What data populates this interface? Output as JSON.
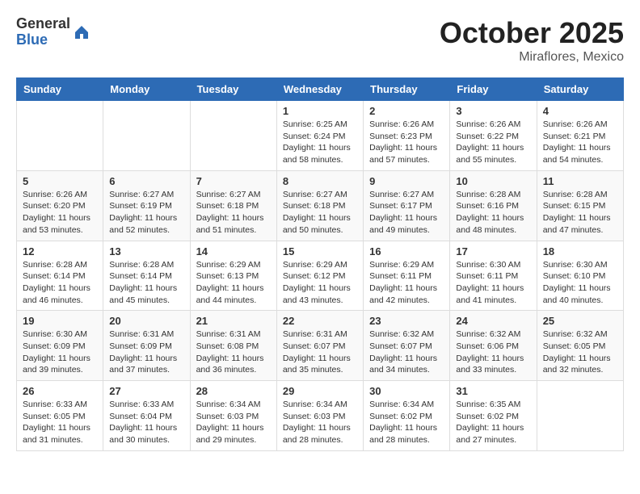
{
  "logo": {
    "general": "General",
    "blue": "Blue"
  },
  "header": {
    "month": "October 2025",
    "location": "Miraflores, Mexico"
  },
  "weekdays": [
    "Sunday",
    "Monday",
    "Tuesday",
    "Wednesday",
    "Thursday",
    "Friday",
    "Saturday"
  ],
  "weeks": [
    [
      {
        "day": "",
        "info": ""
      },
      {
        "day": "",
        "info": ""
      },
      {
        "day": "",
        "info": ""
      },
      {
        "day": "1",
        "info": "Sunrise: 6:25 AM\nSunset: 6:24 PM\nDaylight: 11 hours\nand 58 minutes."
      },
      {
        "day": "2",
        "info": "Sunrise: 6:26 AM\nSunset: 6:23 PM\nDaylight: 11 hours\nand 57 minutes."
      },
      {
        "day": "3",
        "info": "Sunrise: 6:26 AM\nSunset: 6:22 PM\nDaylight: 11 hours\nand 55 minutes."
      },
      {
        "day": "4",
        "info": "Sunrise: 6:26 AM\nSunset: 6:21 PM\nDaylight: 11 hours\nand 54 minutes."
      }
    ],
    [
      {
        "day": "5",
        "info": "Sunrise: 6:26 AM\nSunset: 6:20 PM\nDaylight: 11 hours\nand 53 minutes."
      },
      {
        "day": "6",
        "info": "Sunrise: 6:27 AM\nSunset: 6:19 PM\nDaylight: 11 hours\nand 52 minutes."
      },
      {
        "day": "7",
        "info": "Sunrise: 6:27 AM\nSunset: 6:18 PM\nDaylight: 11 hours\nand 51 minutes."
      },
      {
        "day": "8",
        "info": "Sunrise: 6:27 AM\nSunset: 6:18 PM\nDaylight: 11 hours\nand 50 minutes."
      },
      {
        "day": "9",
        "info": "Sunrise: 6:27 AM\nSunset: 6:17 PM\nDaylight: 11 hours\nand 49 minutes."
      },
      {
        "day": "10",
        "info": "Sunrise: 6:28 AM\nSunset: 6:16 PM\nDaylight: 11 hours\nand 48 minutes."
      },
      {
        "day": "11",
        "info": "Sunrise: 6:28 AM\nSunset: 6:15 PM\nDaylight: 11 hours\nand 47 minutes."
      }
    ],
    [
      {
        "day": "12",
        "info": "Sunrise: 6:28 AM\nSunset: 6:14 PM\nDaylight: 11 hours\nand 46 minutes."
      },
      {
        "day": "13",
        "info": "Sunrise: 6:28 AM\nSunset: 6:14 PM\nDaylight: 11 hours\nand 45 minutes."
      },
      {
        "day": "14",
        "info": "Sunrise: 6:29 AM\nSunset: 6:13 PM\nDaylight: 11 hours\nand 44 minutes."
      },
      {
        "day": "15",
        "info": "Sunrise: 6:29 AM\nSunset: 6:12 PM\nDaylight: 11 hours\nand 43 minutes."
      },
      {
        "day": "16",
        "info": "Sunrise: 6:29 AM\nSunset: 6:11 PM\nDaylight: 11 hours\nand 42 minutes."
      },
      {
        "day": "17",
        "info": "Sunrise: 6:30 AM\nSunset: 6:11 PM\nDaylight: 11 hours\nand 41 minutes."
      },
      {
        "day": "18",
        "info": "Sunrise: 6:30 AM\nSunset: 6:10 PM\nDaylight: 11 hours\nand 40 minutes."
      }
    ],
    [
      {
        "day": "19",
        "info": "Sunrise: 6:30 AM\nSunset: 6:09 PM\nDaylight: 11 hours\nand 39 minutes."
      },
      {
        "day": "20",
        "info": "Sunrise: 6:31 AM\nSunset: 6:09 PM\nDaylight: 11 hours\nand 37 minutes."
      },
      {
        "day": "21",
        "info": "Sunrise: 6:31 AM\nSunset: 6:08 PM\nDaylight: 11 hours\nand 36 minutes."
      },
      {
        "day": "22",
        "info": "Sunrise: 6:31 AM\nSunset: 6:07 PM\nDaylight: 11 hours\nand 35 minutes."
      },
      {
        "day": "23",
        "info": "Sunrise: 6:32 AM\nSunset: 6:07 PM\nDaylight: 11 hours\nand 34 minutes."
      },
      {
        "day": "24",
        "info": "Sunrise: 6:32 AM\nSunset: 6:06 PM\nDaylight: 11 hours\nand 33 minutes."
      },
      {
        "day": "25",
        "info": "Sunrise: 6:32 AM\nSunset: 6:05 PM\nDaylight: 11 hours\nand 32 minutes."
      }
    ],
    [
      {
        "day": "26",
        "info": "Sunrise: 6:33 AM\nSunset: 6:05 PM\nDaylight: 11 hours\nand 31 minutes."
      },
      {
        "day": "27",
        "info": "Sunrise: 6:33 AM\nSunset: 6:04 PM\nDaylight: 11 hours\nand 30 minutes."
      },
      {
        "day": "28",
        "info": "Sunrise: 6:34 AM\nSunset: 6:03 PM\nDaylight: 11 hours\nand 29 minutes."
      },
      {
        "day": "29",
        "info": "Sunrise: 6:34 AM\nSunset: 6:03 PM\nDaylight: 11 hours\nand 28 minutes."
      },
      {
        "day": "30",
        "info": "Sunrise: 6:34 AM\nSunset: 6:02 PM\nDaylight: 11 hours\nand 28 minutes."
      },
      {
        "day": "31",
        "info": "Sunrise: 6:35 AM\nSunset: 6:02 PM\nDaylight: 11 hours\nand 27 minutes."
      },
      {
        "day": "",
        "info": ""
      }
    ]
  ]
}
